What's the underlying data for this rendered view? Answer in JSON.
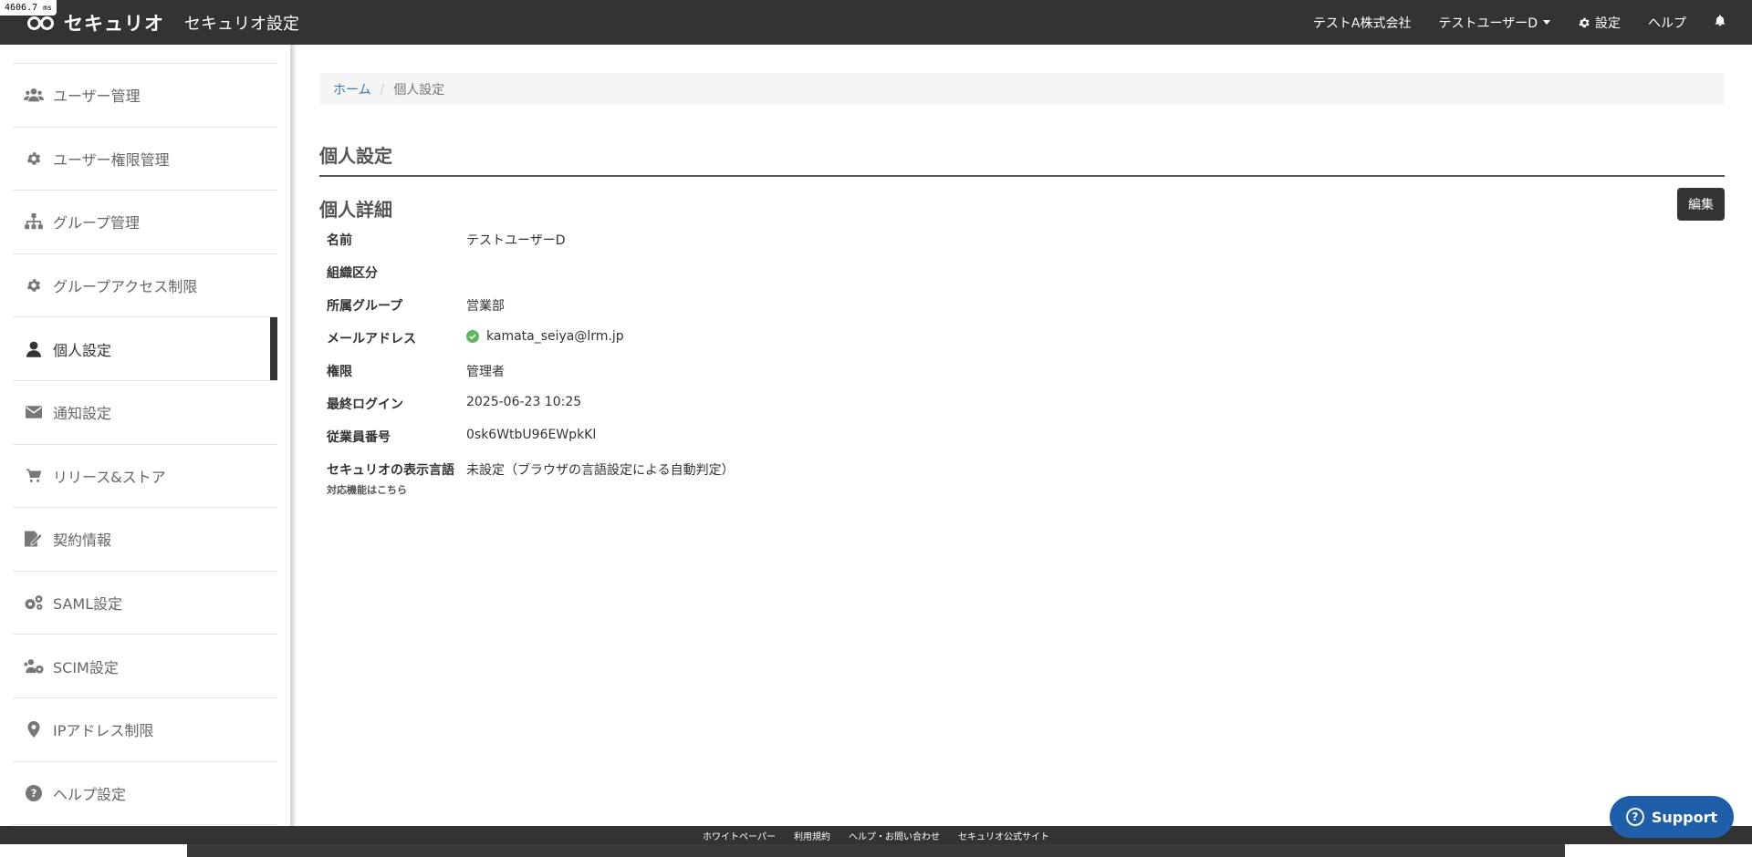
{
  "perf": {
    "value": "4606.7",
    "unit": "ms"
  },
  "header": {
    "logo_text": "セキュリオ",
    "app_title": "セキュリオ設定",
    "company": "テストA株式会社",
    "user": "テストユーザーD",
    "settings": "設定",
    "help": "ヘルプ"
  },
  "sidebar": {
    "items": [
      {
        "label": "ユーザー管理",
        "icon": "users-icon"
      },
      {
        "label": "ユーザー権限管理",
        "icon": "gear-icon"
      },
      {
        "label": "グループ管理",
        "icon": "sitemap-icon"
      },
      {
        "label": "グループアクセス制限",
        "icon": "gear-icon"
      },
      {
        "label": "個人設定",
        "icon": "user-icon",
        "active": true
      },
      {
        "label": "通知設定",
        "icon": "envelope-icon"
      },
      {
        "label": "リリース&ストア",
        "icon": "cart-icon"
      },
      {
        "label": "契約情報",
        "icon": "contract-icon"
      },
      {
        "label": "SAML設定",
        "icon": "gears-icon"
      },
      {
        "label": "SCIM設定",
        "icon": "users-gear-icon"
      },
      {
        "label": "IPアドレス制限",
        "icon": "map-pin-icon"
      },
      {
        "label": "ヘルプ設定",
        "icon": "question-circle-icon"
      }
    ]
  },
  "breadcrumb": {
    "home": "ホーム",
    "current": "個人設定"
  },
  "main": {
    "page_title": "個人設定",
    "detail_title": "個人詳細",
    "edit_label": "編集",
    "rows": [
      {
        "label": "名前",
        "value": "テストユーザーD"
      },
      {
        "label": "組織区分",
        "value": ""
      },
      {
        "label": "所属グループ",
        "value": "営業部"
      },
      {
        "label": "メールアドレス",
        "value": "kamata_seiya@lrm.jp",
        "verified": true
      },
      {
        "label": "権限",
        "value": "管理者"
      },
      {
        "label": "最終ログイン",
        "value": "2025-06-23 10:25"
      },
      {
        "label": "従業員番号",
        "value": "0sk6WtbU96EWpkKl"
      },
      {
        "label": "セキュリオの表示言語",
        "sub_label": "対応機能はこちら",
        "value": "未設定（ブラウザの言語設定による自動判定）"
      }
    ]
  },
  "footer": {
    "links": [
      "ホワイトペーパー",
      "利用規約",
      "ヘルプ・お問い合わせ",
      "セキュリオ公式サイト"
    ]
  },
  "support": {
    "label": "Support"
  },
  "colors": {
    "topbar": "#333333",
    "link": "#337ab7",
    "verified": "#5cb85c",
    "support": "#1f5ea8"
  }
}
